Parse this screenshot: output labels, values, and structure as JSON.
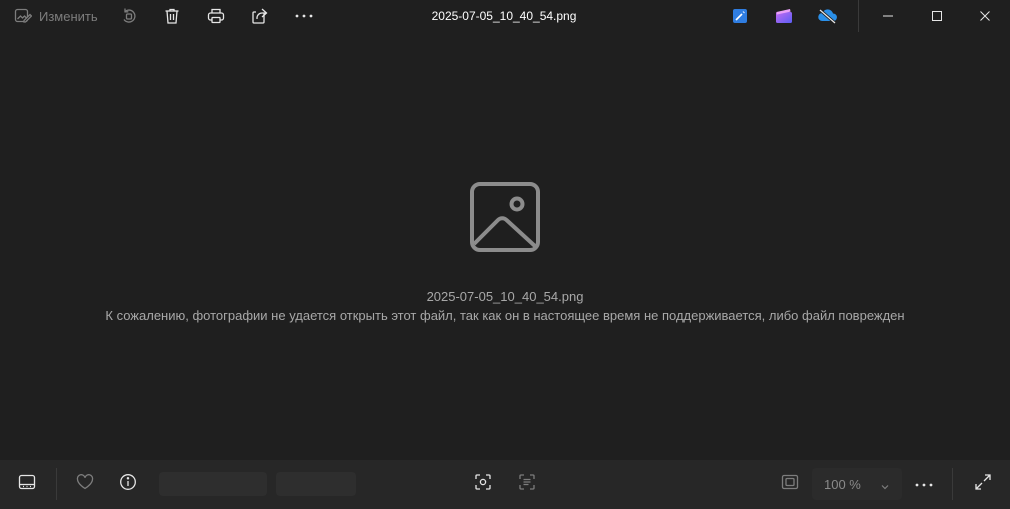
{
  "window": {
    "title": "2025-07-05_10_40_54.png"
  },
  "toolbar": {
    "edit_label": "Изменить",
    "items": [
      {
        "name": "edit",
        "icon": "edit-image-icon"
      },
      {
        "name": "rotate",
        "icon": "rotate-icon"
      },
      {
        "name": "delete",
        "icon": "trash-icon"
      },
      {
        "name": "print",
        "icon": "printer-icon"
      },
      {
        "name": "share",
        "icon": "share-icon"
      },
      {
        "name": "more",
        "icon": "more-horizontal-icon"
      }
    ],
    "app_icons": [
      {
        "name": "designer",
        "icon": "designer-app-icon",
        "color": "#2f7de1"
      },
      {
        "name": "clipchamp",
        "icon": "clipchamp-app-icon",
        "color": "#8b5cf6"
      },
      {
        "name": "onedrive",
        "icon": "onedrive-offline-icon",
        "color": "#2a8fe8"
      }
    ]
  },
  "window_controls": [
    "minimize-icon",
    "maximize-icon",
    "close-icon"
  ],
  "viewer": {
    "icon": "image-placeholder-icon",
    "filename": "2025-07-05_10_40_54.png",
    "error_message": "К сожалению, фотографии не удается открыть этот файл, так как он в настоящее время не поддерживается, либо файл поврежден"
  },
  "bottom_bar": {
    "zoom_value": "100 %",
    "icons": [
      "filmstrip-icon",
      "heart-icon",
      "info-icon",
      "fit-to-window-icon",
      "text-recognition-icon",
      "actual-size-icon",
      "more-horizontal-icon",
      "fullscreen-icon"
    ]
  },
  "colors": {
    "background": "#1f1f1f",
    "bottom_bar": "#272727",
    "accent_blue": "#2f7de1"
  }
}
